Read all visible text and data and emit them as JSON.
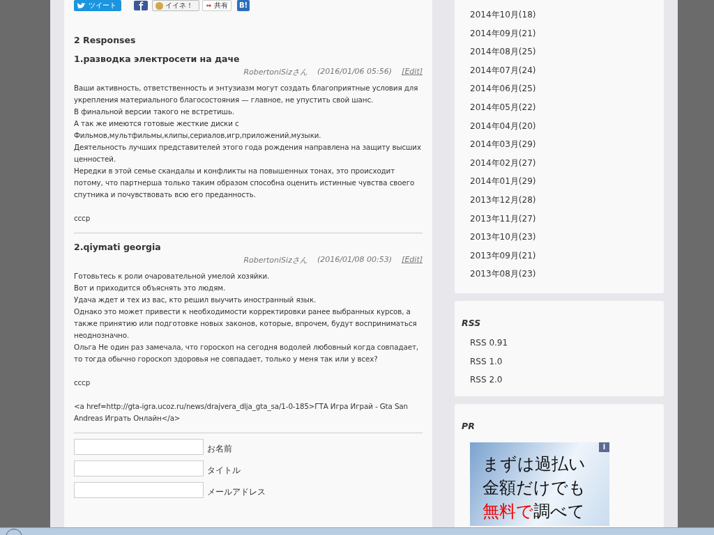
{
  "share_buttons": [
    {
      "kind": "tweet",
      "label": "ツイート"
    },
    {
      "kind": "facebook"
    },
    {
      "kind": "mixi",
      "label": "イイネ！"
    },
    {
      "kind": "gplus",
      "label": "共有"
    },
    {
      "kind": "hatena",
      "label": "B!"
    }
  ],
  "responses_heading": "2 Responses",
  "comments": [
    {
      "title": "1.разводка электросети на даче",
      "author": "RobertoniSizさん",
      "date": "(2016/01/06 05:56)",
      "edit": "[Edit]",
      "paragraphs": [
        [
          "Ваши активность, ответственность и энтузиазм могут создать благоприятные условия для укрепления материального благосостояния — главное, не упустить свой шанс.",
          "В финальной версии такого не встретишь.",
          "А так же имеются готовые жесткие диски с",
          "Фильмов,мультфильмы,клипы,сериалов,игр,приложений,музыки.",
          "Деятельность лучших представителей этого года рождения направлена на защиту высших ценностей.",
          "Нередки в этой семье скандалы и конфликты на повышенных тонах, это происходит потому, что партнерша только таким образом способна оценить истинные чувства своего спутника и почувствовать всю его преданность."
        ],
        [
          "cccp"
        ]
      ]
    },
    {
      "title": "2.qiymati georgia",
      "author": "RobertoniSizさん",
      "date": "(2016/01/08 00:53)",
      "edit": "[Edit]",
      "paragraphs": [
        [
          "Готовьтесь к роли очаровательной умелой хозяйки.",
          "Вот и приходится объяснять это людям.",
          "Удача ждет и тех из вас, кто решил выучить иностранный язык.",
          "Однако это может привести к необходимости корректировки ранее выбранных курсов, а также принятию или подготовке новых законов, которые, впрочем, будут восприниматься неоднозначно.",
          "Ольга Не один раз замечала, что гороскоп на сегодня водолей любовный когда совпадает, то тогда обычно гороскоп здоровья не совпадает, только у меня так или у всех?"
        ],
        [
          "cccp"
        ],
        [
          "<a href=http://gta-igra.ucoz.ru/news/drajvera_dlja_gta_sa/1-0-185>ГТА Игра Играй - Gta San Andreas Играть Онлайн</a>"
        ]
      ]
    }
  ],
  "form_fields": [
    {
      "label": "お名前"
    },
    {
      "label": "タイトル"
    },
    {
      "label": "メールアドレス"
    }
  ],
  "archives": [
    "2014年10月(18)",
    "2014年09月(21)",
    "2014年08月(25)",
    "2014年07月(24)",
    "2014年06月(25)",
    "2014年05月(22)",
    "2014年04月(20)",
    "2014年03月(29)",
    "2014年02月(27)",
    "2014年01月(29)",
    "2013年12月(28)",
    "2013年11月(27)",
    "2013年10月(23)",
    "2013年09月(21)",
    "2013年08月(23)"
  ],
  "rss": {
    "title": "RSS",
    "links": [
      "RSS 0.91",
      "RSS 1.0",
      "RSS 2.0"
    ]
  },
  "pr": {
    "title": "PR",
    "info": "i",
    "ad_lines": [
      [
        {
          "text": "まずは過払い",
          "kind": "normal"
        }
      ],
      [
        {
          "text": "金額だけでも",
          "kind": "normal"
        }
      ],
      [
        {
          "text": "無料で",
          "kind": "accent"
        },
        {
          "text": "調べて",
          "kind": "normal"
        }
      ]
    ]
  }
}
